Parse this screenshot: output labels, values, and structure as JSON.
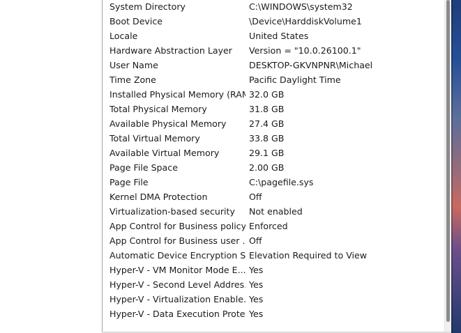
{
  "system_summary": {
    "rows": [
      {
        "item": "System Directory",
        "value": "C:\\WINDOWS\\system32"
      },
      {
        "item": "Boot Device",
        "value": "\\Device\\HarddiskVolume1"
      },
      {
        "item": "Locale",
        "value": "United States"
      },
      {
        "item": "Hardware Abstraction Layer",
        "value": "Version = \"10.0.26100.1\""
      },
      {
        "item": "User Name",
        "value": "DESKTOP-GKVNPNR\\Michael"
      },
      {
        "item": "Time Zone",
        "value": "Pacific Daylight Time"
      },
      {
        "item": "Installed Physical Memory (RAM)",
        "value": "32.0 GB"
      },
      {
        "item": "Total Physical Memory",
        "value": "31.8 GB"
      },
      {
        "item": "Available Physical Memory",
        "value": "27.4 GB"
      },
      {
        "item": "Total Virtual Memory",
        "value": "33.8 GB"
      },
      {
        "item": "Available Virtual Memory",
        "value": "29.1 GB"
      },
      {
        "item": "Page File Space",
        "value": "2.00 GB"
      },
      {
        "item": "Page File",
        "value": "C:\\pagefile.sys"
      },
      {
        "item": "Kernel DMA Protection",
        "value": "Off"
      },
      {
        "item": "Virtualization-based security",
        "value": "Not enabled"
      },
      {
        "item": "App Control for Business policy",
        "value": "Enforced"
      },
      {
        "item": "App Control for Business user ...",
        "value": "Off"
      },
      {
        "item": "Automatic Device Encryption Su...",
        "value": "Elevation Required to View"
      },
      {
        "item": "Hyper-V - VM Monitor Mode E...",
        "value": "Yes"
      },
      {
        "item": "Hyper-V - Second Level Addres...",
        "value": "Yes"
      },
      {
        "item": "Hyper-V - Virtualization Enable...",
        "value": "Yes"
      },
      {
        "item": "Hyper-V - Data Execution Prote...",
        "value": "Yes"
      }
    ]
  }
}
